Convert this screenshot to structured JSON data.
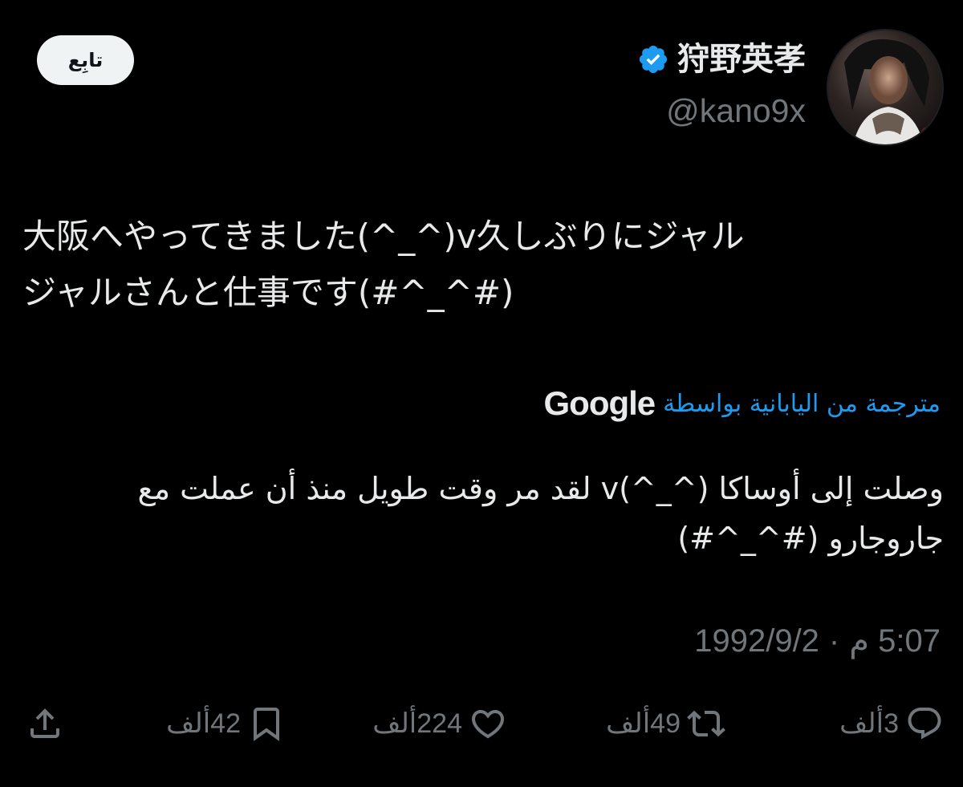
{
  "author": {
    "display_name": "狩野英孝",
    "handle": "@kano9x",
    "verified_color": "#1d9bf0"
  },
  "follow_button": {
    "label": "تابِع"
  },
  "tweet": {
    "text": "大阪へやってきました(^_^)v久しぶりにジャル\nジャルさんと仕事です(#^_^#)",
    "translated_by_label": "مترجمة من اليابانية بواسطة",
    "translated_by_brand": "Google",
    "translated_text": "وصلت إلى أوساكا (^_^)v لقد مر وقت طويل منذ أن عملت مع جاروجارو (#^_^#)",
    "time": "5:07 م",
    "separator": "·",
    "date": "1992/9/2"
  },
  "actions": {
    "replies": "3ألف",
    "reposts": "49ألف",
    "likes": "224ألف",
    "bookmarks": "42ألف"
  },
  "icons": {
    "reply": "reply-icon",
    "repost": "repost-icon",
    "like": "heart-icon",
    "bookmark": "bookmark-icon",
    "share": "share-icon",
    "verified": "verified-badge-icon"
  },
  "colors": {
    "background": "#000000",
    "text": "#e7e9ea",
    "muted": "#71767b",
    "accent": "#1d9bf0",
    "follow_bg": "#eff3f4"
  }
}
